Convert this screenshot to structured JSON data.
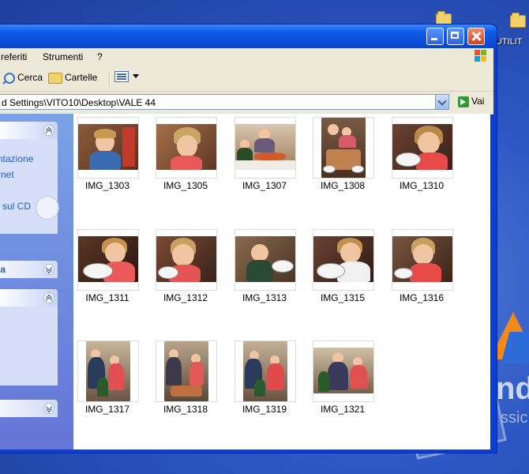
{
  "desktop": {
    "icon_label": "UTILIT",
    "watermark_text": "nde",
    "watermark_sub": "ssic"
  },
  "window": {
    "menu": [
      "referiti",
      "Strumenti",
      "?"
    ],
    "toolbar": {
      "search_label": "Cerca",
      "folders_label": "Cartelle"
    },
    "address": {
      "path": "d Settings\\VITO10\\Desktop\\VALE 44",
      "go_label": "Vai"
    },
    "taskpane": {
      "section1_links": [
        "ntazione",
        "rnet",
        "sul CD"
      ],
      "section2_title": "la"
    },
    "files": [
      {
        "name": "IMG_1303",
        "orientation": "landscape",
        "bg": "#7a4a2e"
      },
      {
        "name": "IMG_1305",
        "orientation": "landscape",
        "bg": "#8a5a3a"
      },
      {
        "name": "IMG_1307",
        "orientation": "landscape",
        "bg": "#9a7a5c"
      },
      {
        "name": "IMG_1308",
        "orientation": "portrait",
        "bg": "#6e4d36"
      },
      {
        "name": "IMG_1310",
        "orientation": "landscape",
        "bg": "#5d3b2a"
      },
      {
        "name": "IMG_1311",
        "orientation": "landscape",
        "bg": "#4a2e22"
      },
      {
        "name": "IMG_1312",
        "orientation": "landscape",
        "bg": "#5a3a2c"
      },
      {
        "name": "IMG_1313",
        "orientation": "landscape",
        "bg": "#6b4b3a"
      },
      {
        "name": "IMG_1315",
        "orientation": "landscape",
        "bg": "#4f3326"
      },
      {
        "name": "IMG_1316",
        "orientation": "landscape",
        "bg": "#5e3f30"
      },
      {
        "name": "IMG_1317",
        "orientation": "portrait",
        "bg": "#7c6a5a"
      },
      {
        "name": "IMG_1318",
        "orientation": "portrait",
        "bg": "#6f5b49"
      },
      {
        "name": "IMG_1319",
        "orientation": "portrait",
        "bg": "#7a6654"
      },
      {
        "name": "IMG_1321",
        "orientation": "landscape",
        "bg": "#8a6f5b"
      }
    ]
  }
}
